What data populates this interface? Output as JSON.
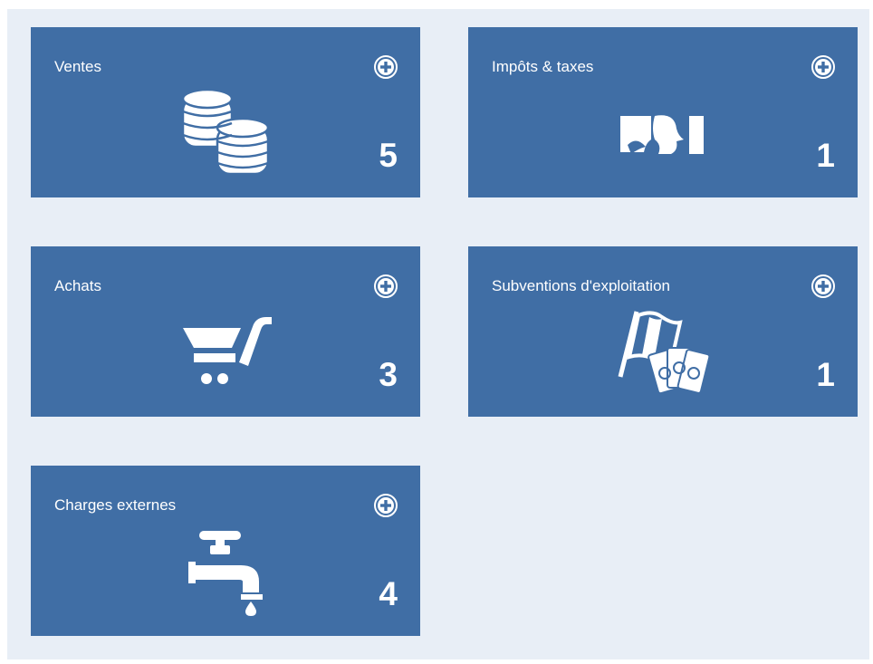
{
  "colors": {
    "tile": "#406ea5",
    "background": "#e8eef6",
    "foreground": "#ffffff"
  },
  "tiles": [
    {
      "label": "Ventes",
      "count": "5",
      "icon": "coins-icon"
    },
    {
      "label": "Impôts & taxes",
      "count": "1",
      "icon": "marianne-icon"
    },
    {
      "label": "Achats",
      "count": "3",
      "icon": "shopping-cart-icon"
    },
    {
      "label": "Subventions d'exploitation",
      "count": "1",
      "icon": "flag-banknotes-icon"
    },
    {
      "label": "Charges externes",
      "count": "4",
      "icon": "water-tap-icon"
    }
  ]
}
